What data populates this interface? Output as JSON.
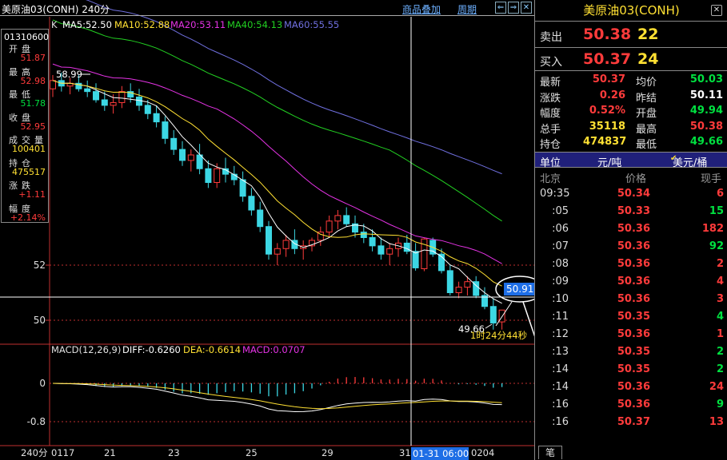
{
  "header": {
    "title": "美原油03(CONH) 240分",
    "menu_overlay": "商品叠加",
    "menu_period": "周期"
  },
  "info_box": {
    "date": "01310600",
    "rows": [
      {
        "label": "开盘",
        "value": "51.87",
        "color": "red"
      },
      {
        "label": "最高",
        "value": "52.98",
        "color": "red"
      },
      {
        "label": "最低",
        "value": "51.78",
        "color": "grn"
      },
      {
        "label": "收盘",
        "value": "52.95",
        "color": "red"
      },
      {
        "label": "成交量",
        "value": "100401",
        "color": "ylw"
      },
      {
        "label": "持仓",
        "value": "475517",
        "color": "ylw"
      },
      {
        "label": "涨跌",
        "value": "+1.11",
        "color": "red"
      },
      {
        "label": "幅度",
        "value": "+2.14%",
        "color": "red"
      }
    ]
  },
  "ma_legend": {
    "k": "K",
    "ma5": "MA5:52.50",
    "ma10": "MA10:52.88",
    "ma20": "MA20:53.11",
    "ma40": "MA40:54.13",
    "ma60": "MA60:55.55"
  },
  "macd_legend": {
    "name": "MACD(12,26,9)",
    "diff": "DIFF:-0.6260",
    "dea": "DEA:-0.6614",
    "macd": "MACD:0.0707"
  },
  "price_axis": [
    "52",
    "50"
  ],
  "macd_axis": [
    "0",
    "-0.8"
  ],
  "date_axis": {
    "period": "240分",
    "labels": [
      "0117",
      "21",
      "23",
      "25",
      "29",
      "31",
      "0204"
    ],
    "crosshair_label": "01-31 06:00"
  },
  "annotations": {
    "high": "58.99",
    "low": "49.66",
    "timer": "1时24分44秒",
    "crosshair_price": "50.91"
  },
  "quote": {
    "title": "美原油03(CONH)",
    "ask_label": "卖出",
    "ask_price": "50.38",
    "ask_vol": "22",
    "bid_label": "买入",
    "bid_price": "50.37",
    "bid_vol": "24",
    "stats": [
      {
        "l1": "最新",
        "v1": "50.37",
        "c1": "red",
        "l2": "均价",
        "v2": "50.03",
        "c2": "grn"
      },
      {
        "l1": "涨跌",
        "v1": "0.26",
        "c1": "red",
        "l2": "昨结",
        "v2": "50.11",
        "c2": "wht"
      },
      {
        "l1": "幅度",
        "v1": "0.52%",
        "c1": "red",
        "l2": "开盘",
        "v2": "49.94",
        "c2": "grn"
      },
      {
        "l1": "总手",
        "v1": "35118",
        "c1": "ylw",
        "l2": "最高",
        "v2": "50.38",
        "c2": "red"
      },
      {
        "l1": "持仓",
        "v1": "474837",
        "c1": "ylw",
        "l2": "最低",
        "v2": "49.66",
        "c2": "grn"
      }
    ],
    "unit_label": "单位",
    "unit_cny": "元/吨",
    "unit_usd": "美元/桶",
    "tick_head": {
      "time": "北京",
      "price": "价格",
      "vol": "现手"
    },
    "ticks": [
      {
        "t": "09:35",
        "p": "50.34",
        "v": "6",
        "c": "red"
      },
      {
        "t": ":05",
        "p": "50.33",
        "v": "15",
        "c": "grn"
      },
      {
        "t": ":06",
        "p": "50.36",
        "v": "182",
        "c": "red"
      },
      {
        "t": ":07",
        "p": "50.36",
        "v": "92",
        "c": "grn"
      },
      {
        "t": ":08",
        "p": "50.36",
        "v": "2",
        "c": "red"
      },
      {
        "t": ":09",
        "p": "50.36",
        "v": "4",
        "c": "red"
      },
      {
        "t": ":10",
        "p": "50.36",
        "v": "3",
        "c": "red"
      },
      {
        "t": ":11",
        "p": "50.35",
        "v": "4",
        "c": "grn"
      },
      {
        "t": ":12",
        "p": "50.36",
        "v": "1",
        "c": "red"
      },
      {
        "t": ":13",
        "p": "50.35",
        "v": "2",
        "c": "grn"
      },
      {
        "t": ":14",
        "p": "50.35",
        "v": "2",
        "c": "grn"
      },
      {
        "t": ":14",
        "p": "50.36",
        "v": "24",
        "c": "red"
      },
      {
        "t": ":16",
        "p": "50.36",
        "v": "9",
        "c": "grn"
      },
      {
        "t": ":16",
        "p": "50.37",
        "v": "13",
        "c": "red"
      }
    ],
    "bottom_tab": "笔"
  },
  "colors": {
    "up": "#ff3b3b",
    "down": "#3cd7e4",
    "ma5": "#ffffff",
    "ma10": "#ffe033",
    "ma20": "#e533e5",
    "ma40": "#22d022",
    "ma60": "#7070e0",
    "axis": "#c03030"
  },
  "chart_data": {
    "type": "candlestick",
    "period": "240分",
    "ylim": [
      49.5,
      59.2
    ],
    "candles": [
      [
        58.4,
        58.9,
        58.1,
        58.7
      ],
      [
        58.7,
        58.99,
        58.3,
        58.5
      ],
      [
        58.5,
        58.8,
        58.2,
        58.6
      ],
      [
        58.6,
        58.9,
        58.3,
        58.4
      ],
      [
        58.4,
        58.7,
        58.1,
        58.3
      ],
      [
        58.3,
        58.6,
        57.9,
        58.0
      ],
      [
        58.0,
        58.3,
        57.6,
        57.8
      ],
      [
        57.8,
        58.2,
        57.5,
        57.9
      ],
      [
        57.9,
        58.5,
        57.7,
        58.3
      ],
      [
        58.3,
        58.6,
        57.9,
        58.1
      ],
      [
        58.1,
        58.4,
        57.6,
        57.8
      ],
      [
        57.8,
        58.0,
        57.3,
        57.5
      ],
      [
        57.5,
        57.8,
        57.0,
        57.2
      ],
      [
        57.2,
        57.4,
        56.4,
        56.6
      ],
      [
        56.6,
        56.9,
        56.0,
        56.2
      ],
      [
        56.2,
        56.5,
        55.6,
        55.8
      ],
      [
        55.8,
        56.2,
        55.4,
        56.0
      ],
      [
        56.0,
        56.4,
        55.3,
        55.5
      ],
      [
        55.5,
        55.8,
        54.8,
        55.0
      ],
      [
        55.0,
        55.7,
        54.8,
        55.5
      ],
      [
        55.5,
        55.9,
        55.0,
        55.3
      ],
      [
        55.3,
        55.6,
        54.9,
        55.1
      ],
      [
        55.1,
        55.4,
        54.3,
        54.5
      ],
      [
        54.5,
        54.8,
        53.8,
        54.0
      ],
      [
        54.0,
        54.3,
        53.2,
        53.4
      ],
      [
        53.4,
        53.6,
        52.2,
        52.4
      ],
      [
        52.4,
        52.8,
        52.0,
        52.6
      ],
      [
        52.6,
        53.1,
        52.3,
        52.9
      ],
      [
        52.9,
        53.3,
        52.4,
        52.6
      ],
      [
        52.6,
        52.9,
        52.2,
        52.7
      ],
      [
        52.7,
        53.0,
        52.5,
        52.9
      ],
      [
        52.9,
        53.4,
        52.7,
        53.2
      ],
      [
        53.2,
        53.8,
        53.0,
        53.6
      ],
      [
        53.6,
        54.0,
        53.3,
        53.8
      ],
      [
        53.8,
        54.1,
        53.4,
        53.5
      ],
      [
        53.5,
        53.8,
        53.0,
        53.2
      ],
      [
        53.2,
        53.5,
        52.8,
        53.0
      ],
      [
        53.0,
        53.3,
        52.5,
        52.7
      ],
      [
        52.7,
        53.0,
        52.2,
        52.4
      ],
      [
        52.4,
        52.8,
        52.0,
        52.6
      ],
      [
        52.6,
        53.0,
        52.3,
        52.8
      ],
      [
        52.8,
        53.1,
        52.4,
        52.5
      ],
      [
        52.5,
        52.8,
        51.8,
        51.9
      ],
      [
        51.87,
        52.98,
        51.78,
        52.95
      ],
      [
        52.9,
        53.0,
        52.3,
        52.4
      ],
      [
        52.4,
        52.6,
        51.7,
        51.8
      ],
      [
        51.8,
        52.0,
        50.9,
        51.0
      ],
      [
        51.0,
        51.4,
        50.8,
        51.2
      ],
      [
        51.2,
        51.6,
        50.9,
        51.4
      ],
      [
        51.4,
        51.6,
        50.8,
        50.9
      ],
      [
        50.9,
        51.2,
        50.4,
        50.5
      ],
      [
        50.5,
        50.8,
        49.66,
        49.9
      ],
      [
        49.94,
        50.38,
        49.66,
        50.37
      ]
    ]
  }
}
